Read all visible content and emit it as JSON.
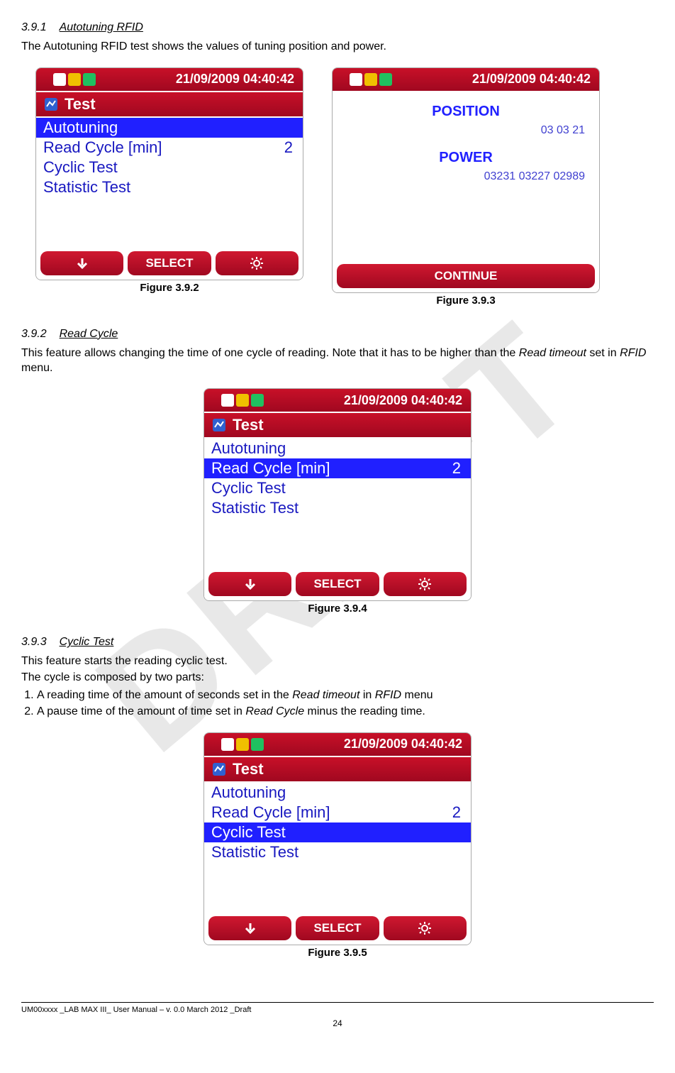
{
  "sec1": {
    "num": "3.9.1",
    "title": "Autotuning RFID",
    "text": "The Autotuning RFID test shows the values of tuning position and power."
  },
  "sec2": {
    "num": "3.9.2",
    "title": "Read Cycle",
    "text_a": "This feature allows changing the time of one cycle of reading. Note that it has to be higher than the ",
    "text_b": "Read timeout",
    "text_c": " set in ",
    "text_d": "RFID",
    "text_e": " menu."
  },
  "sec3": {
    "num": "3.9.3",
    "title": "Cyclic Test",
    "text1": "This feature starts the reading cyclic test.",
    "text2": "The cycle is composed by two parts:",
    "li1_a": "A reading time of the amount of seconds set in the ",
    "li1_b": "Read timeout",
    "li1_c": " in ",
    "li1_d": "RFID",
    "li1_e": " menu",
    "li2_a": "A pause time of the amount of time set in ",
    "li2_b": "Read Cycle",
    "li2_c": " minus the reading time."
  },
  "status": {
    "datetime": "21/09/2009 04:40:42"
  },
  "menu": {
    "title": "Test",
    "items": [
      {
        "label": "Autotuning",
        "val": ""
      },
      {
        "label": "Read Cycle [min]",
        "val": "2"
      },
      {
        "label": "Cyclic Test",
        "val": ""
      },
      {
        "label": "Statistic Test",
        "val": ""
      }
    ]
  },
  "position": {
    "label": "POSITION",
    "val": "03 03 21"
  },
  "power": {
    "label": "POWER",
    "val": "03231 03227 02989"
  },
  "sk": {
    "select": "SELECT",
    "continue": "CONTINUE"
  },
  "fig": {
    "f392": "Figure 3.9.2",
    "f393": "Figure 3.9.3",
    "f394": "Figure 3.9.4",
    "f395": "Figure 3.9.5"
  },
  "footer": {
    "text": "UM00xxxx _LAB MAX III_ User Manual – v. 0.0 March 2012 _Draft",
    "page": "24"
  }
}
